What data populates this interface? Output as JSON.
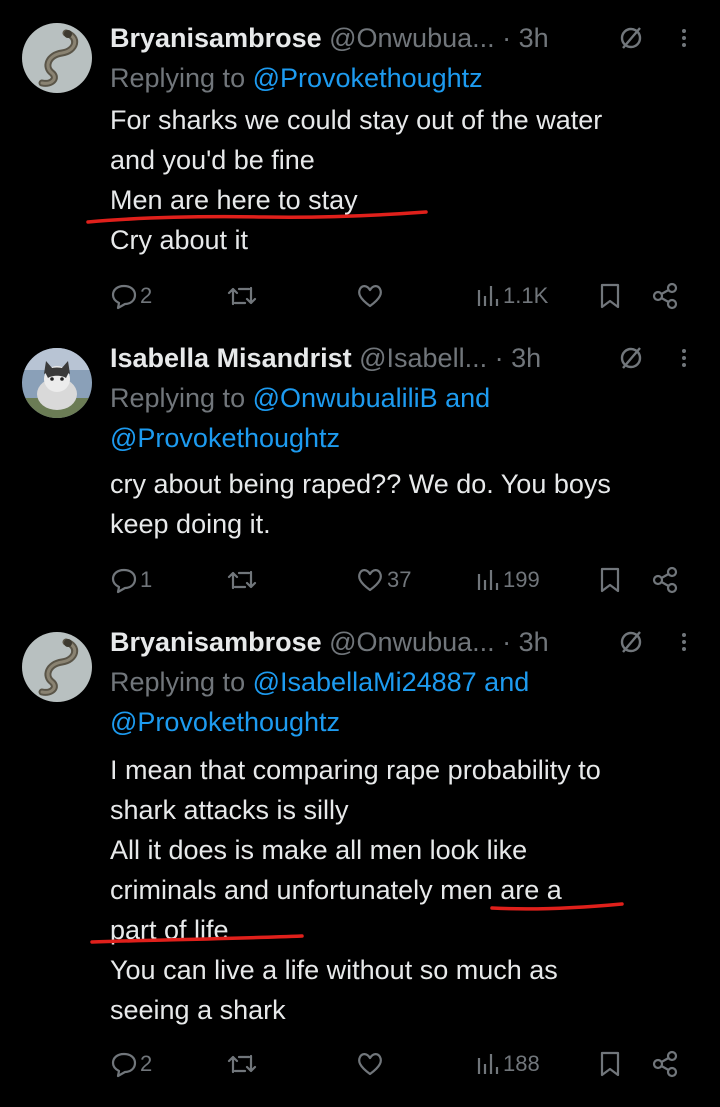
{
  "tweets": [
    {
      "name": "Bryanisambrose",
      "handle": "@Onwubua...",
      "time": "· 3h",
      "replying_prefix": "Replying to",
      "mentions": [
        "@Provokethoughtz"
      ],
      "mention_joiner": "",
      "lines": [
        "For sharks we could stay out of the water",
        "and you'd be fine",
        "Men are here to stay",
        "Cry about it"
      ],
      "counts": {
        "replies": "2",
        "reposts": "",
        "likes": "",
        "views": "1.1K"
      }
    },
    {
      "name": "Isabella Misandrist",
      "handle": "@Isabell...",
      "time": "· 3h",
      "replying_prefix": "Replying to",
      "mentions": [
        "@OnwubualiliB",
        "@Provokethoughtz"
      ],
      "mention_joiner": "and",
      "lines": [
        "cry about being raped?? We do. You boys",
        "keep doing it."
      ],
      "counts": {
        "replies": "1",
        "reposts": "",
        "likes": "37",
        "views": "199"
      }
    },
    {
      "name": "Bryanisambrose",
      "handle": "@Onwubua...",
      "time": "· 3h",
      "replying_prefix": "Replying to",
      "mentions": [
        "@IsabellaMi24887",
        "@Provokethoughtz"
      ],
      "mention_joiner": "and",
      "lines": [
        "I mean that comparing rape probability to",
        "shark attacks is silly",
        "All it does is make all men look like",
        "criminals and unfortunately men are a",
        "part of life",
        "You can live a life without so much as",
        "seeing a shark"
      ],
      "counts": {
        "replies": "2",
        "reposts": "",
        "likes": "",
        "views": "188"
      }
    }
  ],
  "colors": {
    "background": "#000000",
    "text": "#e7e9ea",
    "muted": "#71767b",
    "link": "#1d9bf0",
    "annotation": "#e0201b"
  },
  "icons": [
    "snake-avatar",
    "cat-avatar",
    "mute-icon",
    "more-icon",
    "reply-icon",
    "repost-icon",
    "like-icon",
    "views-icon",
    "bookmark-icon",
    "share-icon"
  ]
}
